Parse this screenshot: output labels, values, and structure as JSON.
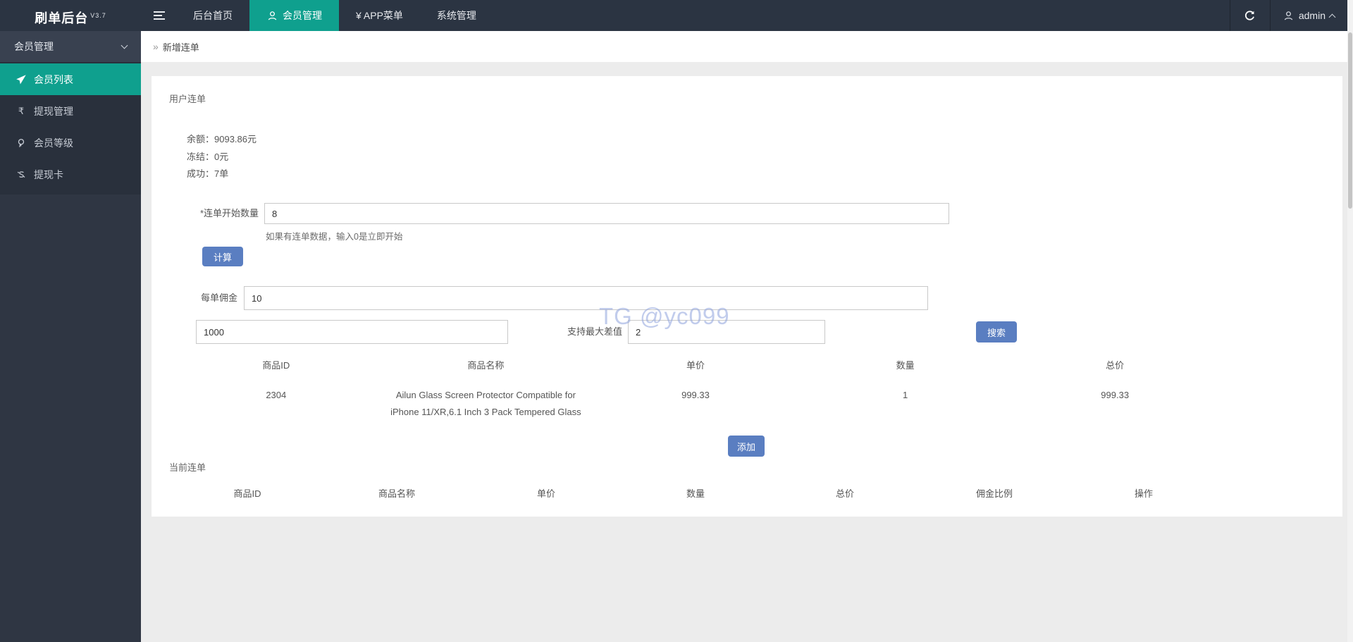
{
  "topbar": {
    "logo": "刷单后台",
    "version": "V3.7",
    "nav": [
      {
        "label": "后台首页"
      },
      {
        "label": "会员管理"
      },
      {
        "label": "¥ APP菜单"
      },
      {
        "label": "系统管理"
      }
    ],
    "user": {
      "name": "admin"
    }
  },
  "sidebar": {
    "group_label": "会员管理",
    "items": [
      {
        "label": "会员列表"
      },
      {
        "label": "提现管理"
      },
      {
        "label": "会员等级"
      },
      {
        "label": "提现卡"
      }
    ]
  },
  "breadcrumb": {
    "icon": "»",
    "label": "新增连单"
  },
  "panel": {
    "section_title": "用户连单",
    "stats": [
      {
        "label": "余额：",
        "value": "9093.86元"
      },
      {
        "label": "冻结：",
        "value": "0元"
      },
      {
        "label": "成功：",
        "value": "7单"
      }
    ],
    "form": {
      "start_qty_label": "*连单开始数量",
      "start_qty_value": "8",
      "start_qty_help": "如果有连单数据，输入0是立即开始",
      "calc_button": "计算",
      "commission_label": "每单佣金",
      "commission_value": "10",
      "price_value": "1000",
      "max_diff_label": "支持最大差值",
      "max_diff_value": "2",
      "search_button": "搜索"
    },
    "watermark": "TG @yc099",
    "product_table": {
      "headers": [
        "商品ID",
        "商品名称",
        "单价",
        "数量",
        "总价"
      ],
      "rows": [
        [
          "2304",
          "Ailun Glass Screen Protector Compatible for iPhone 11/XR,6.1 Inch 3 Pack Tempered Glass",
          "999.33",
          "1",
          "999.33"
        ]
      ]
    },
    "add_button": "添加",
    "current_title": "当前连单",
    "current_table": {
      "headers": [
        "商品ID",
        "商品名称",
        "单价",
        "数量",
        "总价",
        "佣金比例",
        "操作"
      ],
      "rows": []
    }
  },
  "colors": {
    "accent_teal": "#0fa08e",
    "button_blue": "#5a7ec1",
    "topbar_bg": "#2b3442",
    "sidebar_bg": "#2f3643"
  }
}
